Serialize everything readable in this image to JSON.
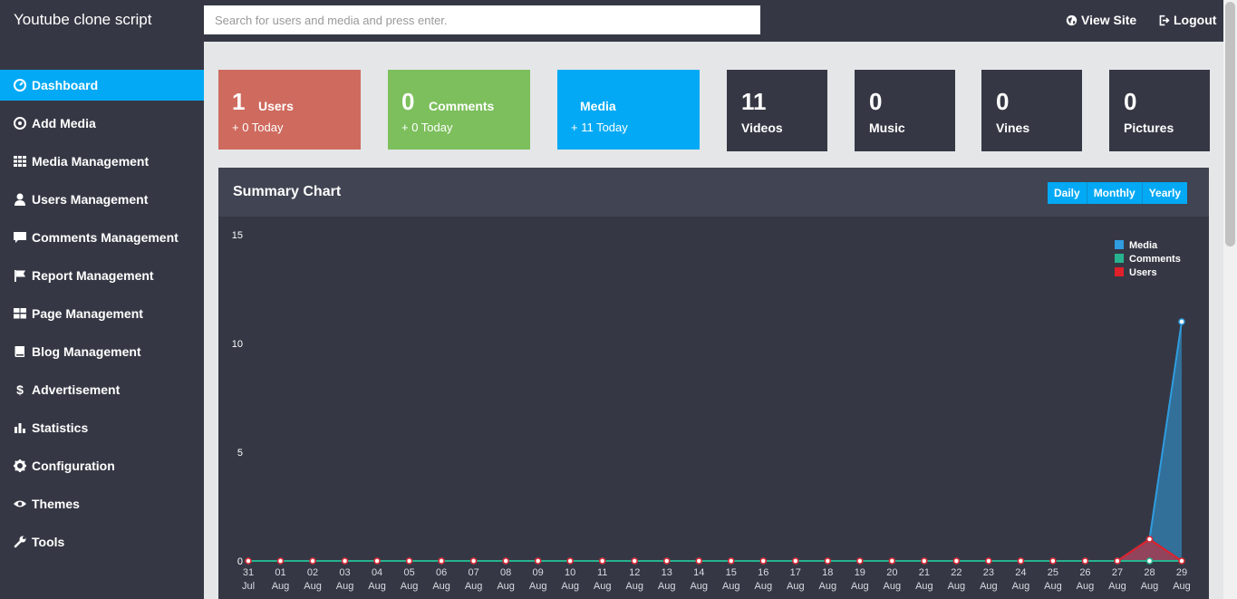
{
  "header": {
    "brand": "Youtube clone script",
    "search_placeholder": "Search for users and media and press enter.",
    "view_site": "View Site",
    "logout": "Logout"
  },
  "sidebar": {
    "items": [
      {
        "label": "Dashboard",
        "icon": "dashboard-icon",
        "active": true
      },
      {
        "label": "Add Media",
        "icon": "plus-circle-icon"
      },
      {
        "label": "Media Management",
        "icon": "grid-icon"
      },
      {
        "label": "Users Management",
        "icon": "user-icon"
      },
      {
        "label": "Comments Management",
        "icon": "comment-icon"
      },
      {
        "label": "Report Management",
        "icon": "flag-icon"
      },
      {
        "label": "Page Management",
        "icon": "layout-icon"
      },
      {
        "label": "Blog Management",
        "icon": "book-icon"
      },
      {
        "label": "Advertisement",
        "icon": "dollar-icon"
      },
      {
        "label": "Statistics",
        "icon": "bar-chart-icon"
      },
      {
        "label": "Configuration",
        "icon": "gear-icon"
      },
      {
        "label": "Themes",
        "icon": "eye-icon"
      },
      {
        "label": "Tools",
        "icon": "wrench-icon"
      }
    ]
  },
  "stats": {
    "users": {
      "value": "1",
      "label": "Users",
      "today": "+ 0 Today",
      "color": "#cf6a5e"
    },
    "comments": {
      "value": "0",
      "label": "Comments",
      "today": "+ 0 Today",
      "color": "#7cbf5c"
    },
    "media": {
      "value": "",
      "label": "Media",
      "today": "+ 11 Today",
      "color": "#03a9f4"
    },
    "videos": {
      "value": "11",
      "label": "Videos"
    },
    "music": {
      "value": "0",
      "label": "Music"
    },
    "vines": {
      "value": "0",
      "label": "Vines"
    },
    "pictures": {
      "value": "0",
      "label": "Pictures"
    }
  },
  "chart_panel": {
    "title": "Summary Chart",
    "buttons": [
      "Daily",
      "Monthly",
      "Yearly"
    ]
  },
  "chart_data": {
    "type": "area",
    "categories": [
      "31 Jul",
      "01 Aug",
      "02 Aug",
      "03 Aug",
      "04 Aug",
      "05 Aug",
      "06 Aug",
      "07 Aug",
      "08 Aug",
      "09 Aug",
      "10 Aug",
      "11 Aug",
      "12 Aug",
      "13 Aug",
      "14 Aug",
      "15 Aug",
      "16 Aug",
      "17 Aug",
      "18 Aug",
      "19 Aug",
      "20 Aug",
      "21 Aug",
      "22 Aug",
      "23 Aug",
      "24 Aug",
      "25 Aug",
      "26 Aug",
      "27 Aug",
      "28 Aug",
      "29 Aug"
    ],
    "series": [
      {
        "name": "Media",
        "color": "#2f9de0",
        "values": [
          0,
          0,
          0,
          0,
          0,
          0,
          0,
          0,
          0,
          0,
          0,
          0,
          0,
          0,
          0,
          0,
          0,
          0,
          0,
          0,
          0,
          0,
          0,
          0,
          0,
          0,
          0,
          0,
          1,
          11
        ]
      },
      {
        "name": "Comments",
        "color": "#27b38f",
        "values": [
          0,
          0,
          0,
          0,
          0,
          0,
          0,
          0,
          0,
          0,
          0,
          0,
          0,
          0,
          0,
          0,
          0,
          0,
          0,
          0,
          0,
          0,
          0,
          0,
          0,
          0,
          0,
          0,
          0,
          0
        ]
      },
      {
        "name": "Users",
        "color": "#e0202a",
        "values": [
          0,
          0,
          0,
          0,
          0,
          0,
          0,
          0,
          0,
          0,
          0,
          0,
          0,
          0,
          0,
          0,
          0,
          0,
          0,
          0,
          0,
          0,
          0,
          0,
          0,
          0,
          0,
          0,
          1,
          0
        ]
      }
    ],
    "yticks": [
      0,
      5,
      10,
      15
    ],
    "ylim": [
      0,
      15
    ],
    "legend": "top-right"
  }
}
